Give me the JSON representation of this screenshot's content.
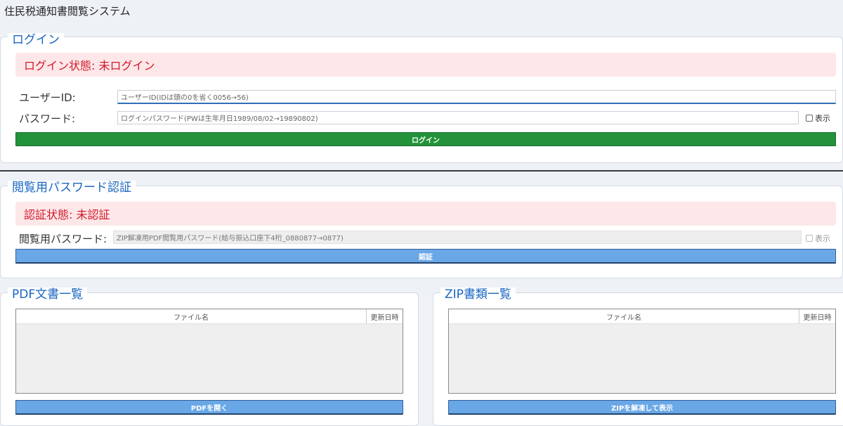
{
  "app": {
    "title": "住民税通知書閲覧システム"
  },
  "login": {
    "legend": "ログイン",
    "status": "ログイン状態: 未ログイン",
    "user_id_label": "ユーザーID:",
    "user_id_placeholder": "ユーザーID(IDは頭の0を省く0056→56)",
    "password_label": "パスワード:",
    "password_placeholder": "ログインパスワード(PWは生年月日1989/08/02→19890802)",
    "show_label": "表示",
    "button_label": "ログイン"
  },
  "view_auth": {
    "legend": "閲覧用パスワード認証",
    "status": "認証状態: 未認証",
    "password_label": "閲覧用パスワード:",
    "password_placeholder": "ZIP解凍用PDF閲覧用パスワード(給与振込口座下4桁_0880877→0877)",
    "show_label": "表示",
    "button_label": "認証"
  },
  "pdf_list": {
    "legend": "PDF文書一覧",
    "columns": [
      "ファイル名",
      "更新日時"
    ],
    "rows": [],
    "button_label": "PDFを開く"
  },
  "zip_list": {
    "legend": "ZIP書類一覧",
    "columns": [
      "ファイル名",
      "更新日時"
    ],
    "rows": [],
    "button_label": "ZIPを解凍して表示"
  },
  "colors": {
    "accent": "#1a66c2",
    "status_error": "#d11a2a",
    "status_bg": "#fde7e9",
    "login_button": "#23923a",
    "action_button": "#6aa7e6"
  }
}
